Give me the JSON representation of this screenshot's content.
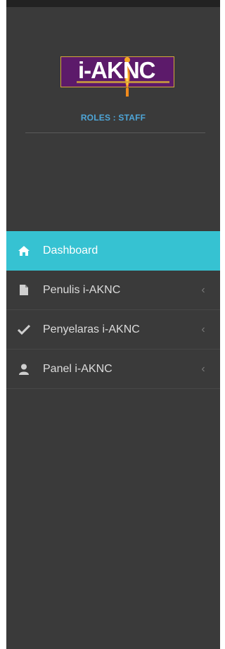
{
  "brand": {
    "logo_text": "i-AKNC",
    "roles_text": "ROLES : STAFF"
  },
  "menu": {
    "items": [
      {
        "label": "Dashboard",
        "icon": "home-icon",
        "active": true
      },
      {
        "label": "Penulis i-AKNC",
        "icon": "file-icon",
        "active": false,
        "chevron": "‹"
      },
      {
        "label": "Penyelaras i-AKNC",
        "icon": "check-icon",
        "active": false,
        "chevron": "‹"
      },
      {
        "label": "Panel i-AKNC",
        "icon": "user-icon",
        "active": false,
        "chevron": "‹"
      }
    ]
  },
  "colors": {
    "sidebar_bg": "#3a3a3a",
    "active_bg": "#36c2d2",
    "roles_text": "#4ea6d8",
    "logo_bg": "#5c1a6a"
  }
}
